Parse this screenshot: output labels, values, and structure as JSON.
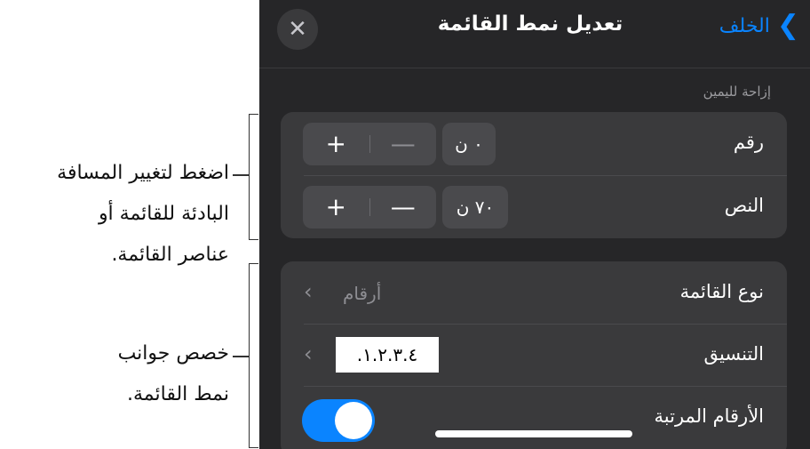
{
  "callouts": {
    "indent": [
      "اضغط لتغيير المسافة",
      "البادئة للقائمة أو",
      "عناصر القائمة."
    ],
    "customize": [
      "خصص جوانب",
      "نمط القائمة."
    ]
  },
  "header": {
    "title": "تعديل نمط القائمة",
    "back_label": "الخلف",
    "close_symbol": "✕",
    "back_chevron": "❯"
  },
  "indent_section": {
    "label": "إزاحة لليمين",
    "rows": [
      {
        "label": "رقم",
        "value": "٠ ن",
        "plus": "+",
        "minus": "—"
      },
      {
        "label": "النص",
        "value": "٧٠ ن",
        "plus": "+",
        "minus": "—"
      }
    ]
  },
  "style_section": {
    "list_type": {
      "label": "نوع القائمة",
      "value": "أرقام",
      "chevron": "‹"
    },
    "format": {
      "label": "التنسيق",
      "value": "١.٢.٣.٤.",
      "chevron": "‹"
    },
    "tiered": {
      "label": "الأرقام المرتبة",
      "on": true
    }
  },
  "colors": {
    "accent": "#0a84ff",
    "panel": "#262628",
    "card": "#3a3a3c"
  }
}
